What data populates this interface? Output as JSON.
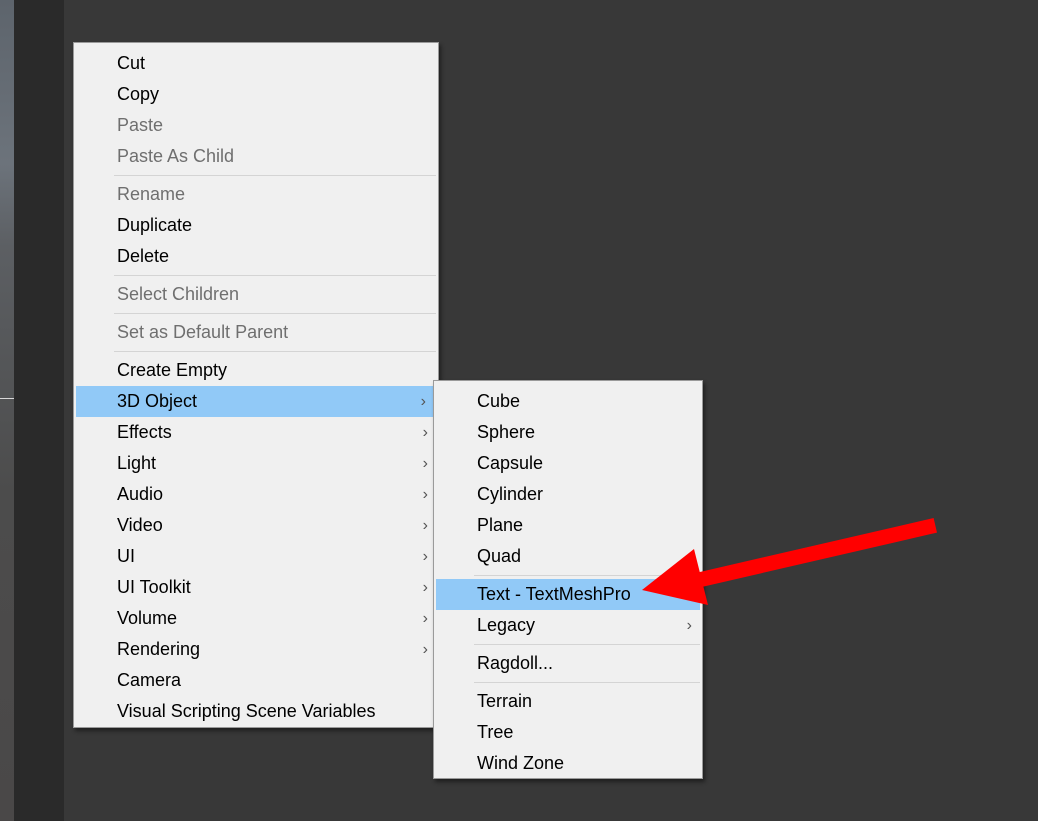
{
  "context_menu": {
    "items": [
      {
        "label": "Cut",
        "enabled": true
      },
      {
        "label": "Copy",
        "enabled": true
      },
      {
        "label": "Paste",
        "enabled": false
      },
      {
        "label": "Paste As Child",
        "enabled": false
      },
      {
        "label": "Rename",
        "enabled": false
      },
      {
        "label": "Duplicate",
        "enabled": true
      },
      {
        "label": "Delete",
        "enabled": true
      },
      {
        "label": "Select Children",
        "enabled": false
      },
      {
        "label": "Set as Default Parent",
        "enabled": false
      },
      {
        "label": "Create Empty",
        "enabled": true
      },
      {
        "label": "3D Object",
        "enabled": true,
        "submenu": true,
        "highlighted": true
      },
      {
        "label": "Effects",
        "enabled": true,
        "submenu": true
      },
      {
        "label": "Light",
        "enabled": true,
        "submenu": true
      },
      {
        "label": "Audio",
        "enabled": true,
        "submenu": true
      },
      {
        "label": "Video",
        "enabled": true,
        "submenu": true
      },
      {
        "label": "UI",
        "enabled": true,
        "submenu": true
      },
      {
        "label": "UI Toolkit",
        "enabled": true,
        "submenu": true
      },
      {
        "label": "Volume",
        "enabled": true,
        "submenu": true
      },
      {
        "label": "Rendering",
        "enabled": true,
        "submenu": true
      },
      {
        "label": "Camera",
        "enabled": true
      },
      {
        "label": "Visual Scripting Scene Variables",
        "enabled": true
      }
    ]
  },
  "submenu_3d_object": {
    "items": [
      {
        "label": "Cube"
      },
      {
        "label": "Sphere"
      },
      {
        "label": "Capsule"
      },
      {
        "label": "Cylinder"
      },
      {
        "label": "Plane"
      },
      {
        "label": "Quad"
      },
      {
        "label": "Text - TextMeshPro",
        "highlighted": true
      },
      {
        "label": "Legacy",
        "submenu": true
      },
      {
        "label": "Ragdoll..."
      },
      {
        "label": "Terrain"
      },
      {
        "label": "Tree"
      },
      {
        "label": "Wind Zone"
      }
    ]
  },
  "icons": {
    "submenu_arrow": "chevron-right-icon",
    "annotation": "red-arrow-icon"
  },
  "colors": {
    "menu_bg": "#f0f0f0",
    "highlight": "#91c9f7",
    "disabled_text": "#6f6f6f",
    "annotation_arrow": "#ff0000",
    "editor_bg": "#383838"
  }
}
